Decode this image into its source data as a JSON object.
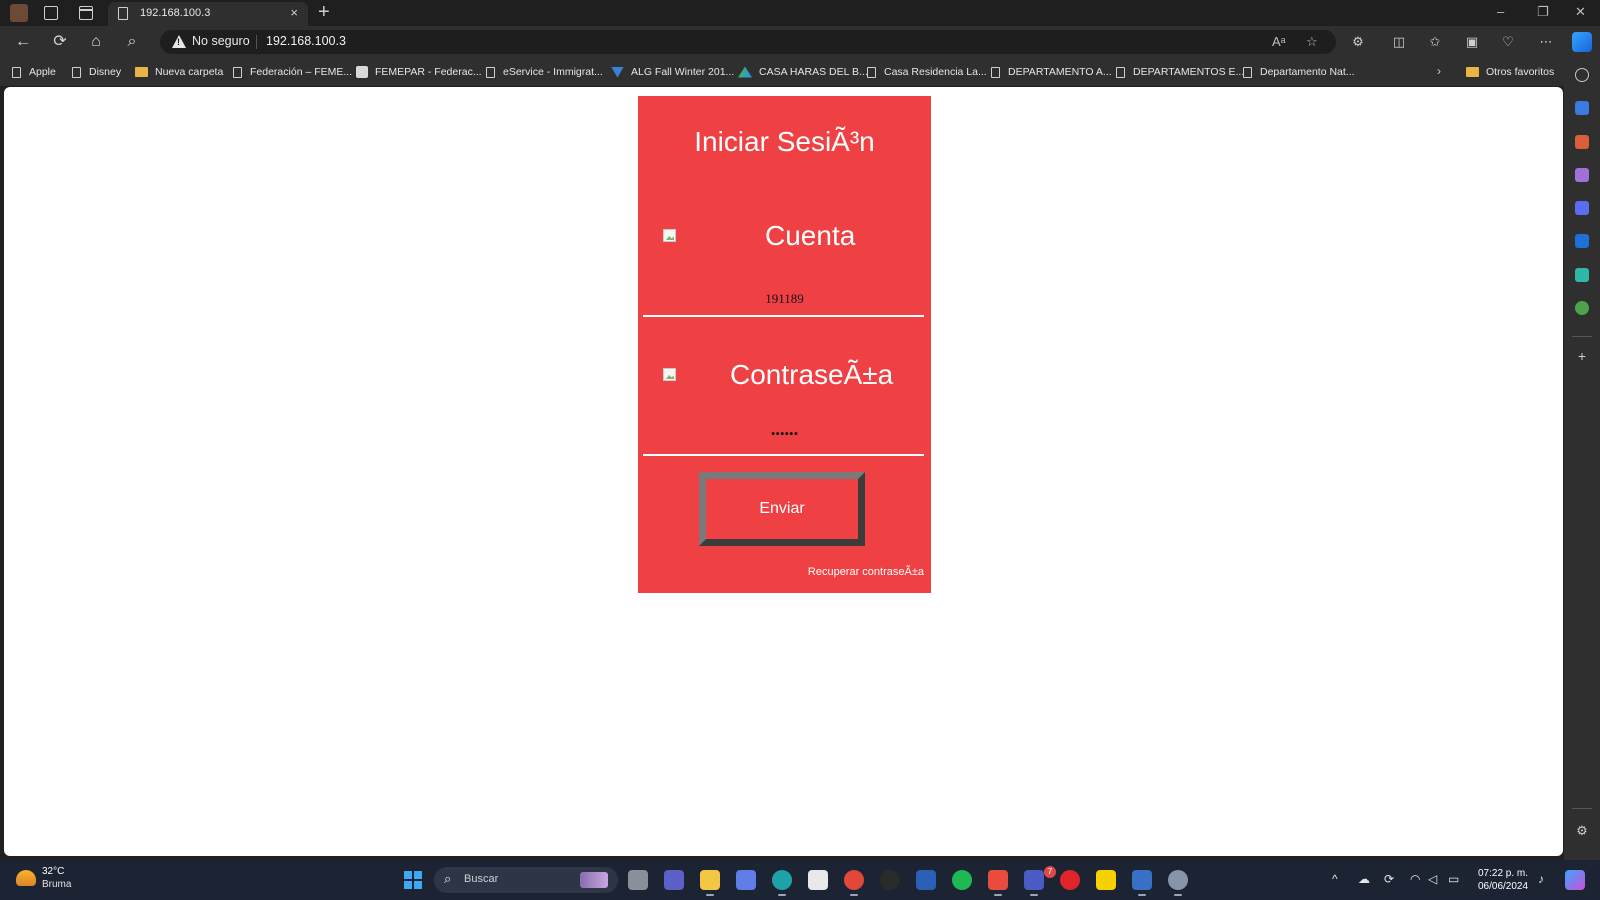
{
  "browser": {
    "tab": {
      "title": "192.168.100.3",
      "close_glyph": "×"
    },
    "new_tab_glyph": "+",
    "window_controls": {
      "minimize": "–",
      "restore": "❐",
      "close": "✕"
    },
    "address": {
      "security_label": "No seguro",
      "url": "192.168.100.3"
    },
    "favorites": [
      {
        "label": "Apple",
        "icon": "page-icon"
      },
      {
        "label": "Disney",
        "icon": "page-icon"
      },
      {
        "label": "Nueva carpeta",
        "icon": "folder-icon"
      },
      {
        "label": "Federación – FEME...",
        "icon": "page-icon"
      },
      {
        "label": "FEMEPAR - Federac...",
        "icon": "site-icon"
      },
      {
        "label": "eService - Immigrat...",
        "icon": "page-icon"
      },
      {
        "label": "ALG Fall Winter 201...",
        "icon": "site-icon"
      },
      {
        "label": "CASA HARAS DEL B...",
        "icon": "site-icon"
      },
      {
        "label": "Casa Residencia La...",
        "icon": "page-icon"
      },
      {
        "label": "DEPARTAMENTO A...",
        "icon": "page-icon"
      },
      {
        "label": "DEPARTAMENTOS E...",
        "icon": "page-icon"
      },
      {
        "label": "Departamento Nat...",
        "icon": "page-icon"
      }
    ],
    "other_favorites": "Otros favoritos"
  },
  "login": {
    "title": "Iniciar SesiÃ³n",
    "account_label": "Cuenta",
    "account_value": "191189",
    "password_label": "ContraseÃ±a",
    "password_value": "••••••",
    "submit_label": "Enviar",
    "recover_link": "Recuperar contraseÃ±a",
    "card_color": "#ef4044"
  },
  "taskbar": {
    "weather": {
      "temp": "32°C",
      "condition": "Bruma"
    },
    "search_placeholder": "Buscar",
    "teams_badge": "7",
    "clock": {
      "time": "07:22 p. m.",
      "date": "06/06/2024"
    }
  }
}
